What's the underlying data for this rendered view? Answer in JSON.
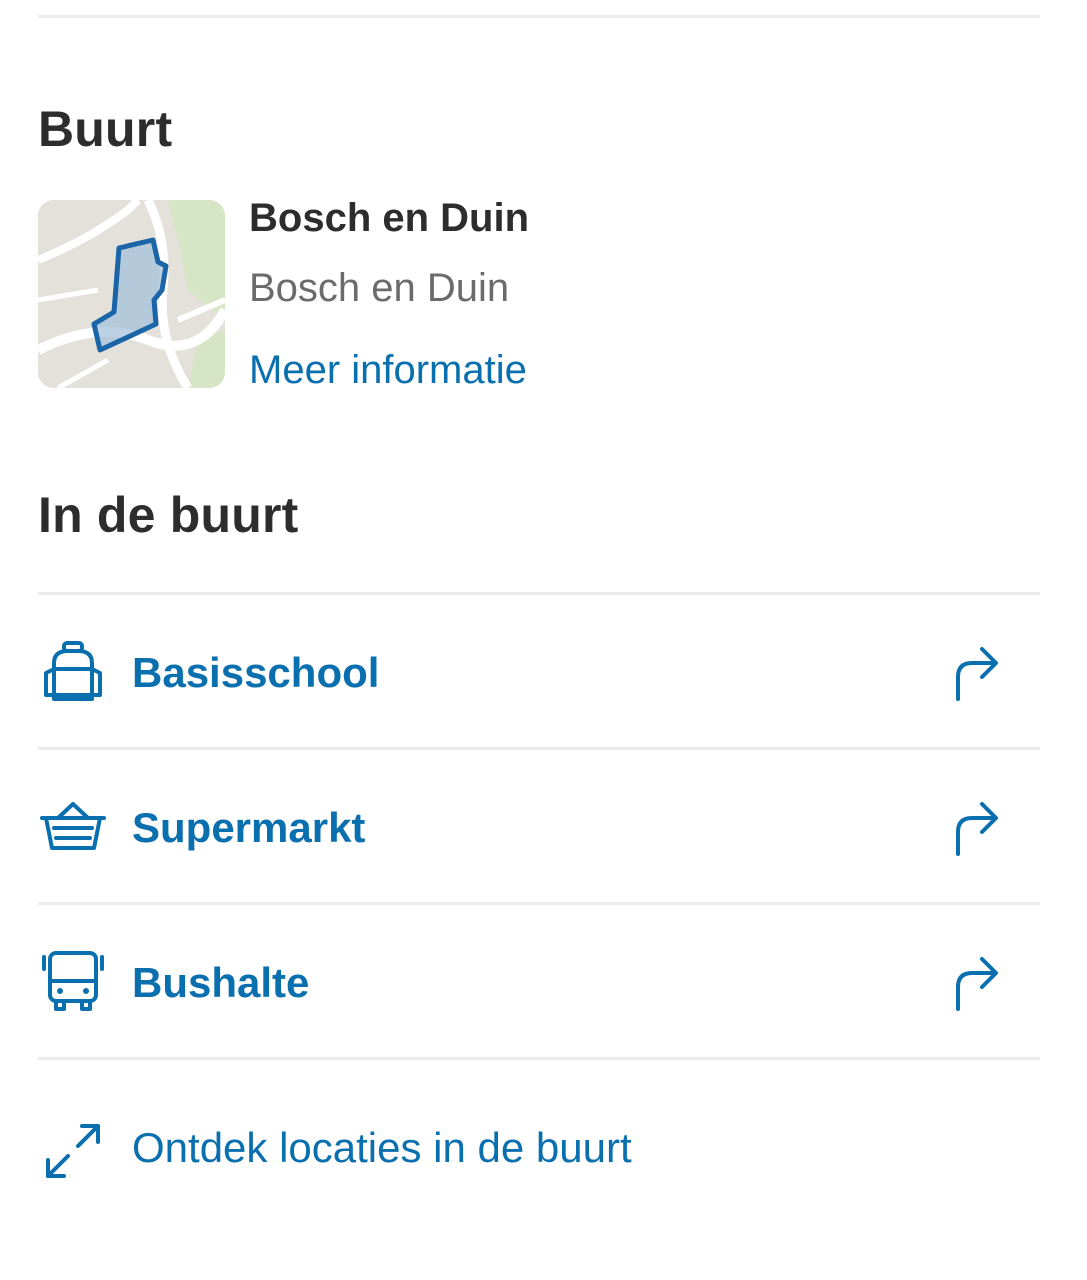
{
  "sections": {
    "buurt_title": "Buurt",
    "nearby_title": "In de buurt"
  },
  "buurt": {
    "name": "Bosch en Duin",
    "subtitle": "Bosch en Duin",
    "more_link": "Meer informatie",
    "map_icon": "neighbourhood-map-thumbnail"
  },
  "nearby": {
    "items": [
      {
        "label": "Basisschool",
        "icon": "backpack-icon",
        "action_icon": "directions-arrow-icon"
      },
      {
        "label": "Supermarkt",
        "icon": "basket-icon",
        "action_icon": "directions-arrow-icon"
      },
      {
        "label": "Bushalte",
        "icon": "bus-icon",
        "action_icon": "directions-arrow-icon"
      }
    ],
    "discover_label": "Ontdek locaties in de buurt",
    "discover_icon": "expand-icon"
  },
  "colors": {
    "accent": "#0a6fae",
    "heading": "#2d2d2d",
    "muted": "#6b6b6b",
    "divider": "#ececec"
  }
}
